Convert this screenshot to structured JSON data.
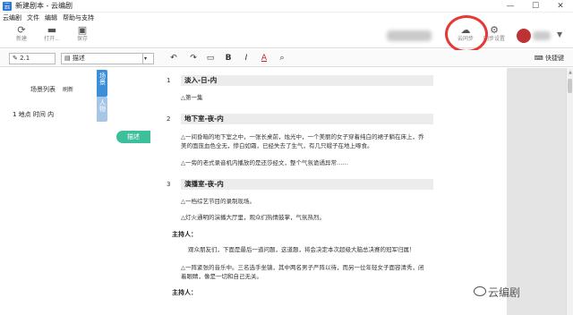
{
  "window": {
    "title": "新建剧本 - 云编剧",
    "minimize": "—",
    "maximize": "☐",
    "close": "✕"
  },
  "menu": [
    "云编剧",
    "文件",
    "编辑",
    "帮助与支持"
  ],
  "toolbar": {
    "new_label": "新建",
    "open_label": "打开...",
    "save_label": "保存",
    "sync_label": "云同步",
    "settings_label": "同步设置"
  },
  "format_bar": {
    "scene_index": "2.1",
    "element_type": "描述",
    "bold": "B",
    "italic": "I",
    "color": "A",
    "shortcut_label": "快捷键"
  },
  "left_panel": {
    "title": "场景列表",
    "refresh": "刷新",
    "scenes": [
      "1 地点 时间 内"
    ]
  },
  "tabs": {
    "scene": "场景",
    "character": "人物"
  },
  "active_element_tag": "描述",
  "script": {
    "scenes": [
      {
        "number": "1",
        "heading": "淡入-日-内",
        "lines": [
          "△第一集"
        ]
      },
      {
        "number": "2",
        "heading": "地下室-夜-内",
        "lines": [
          "△一间昏暗的地下室之中，一张长桌前，烛光中，一个美丽的女子穿着纯白的裙子躺在床上，乔",
          "美的面庞血色全无，惨白如霜，已经失去了生气，有几只蛾子在地上啄食。",
          "△一旁的老式录音机内播放的是还莎经文，整个气氛诡谲异常……"
        ]
      },
      {
        "number": "3",
        "heading": "演播室-夜-内",
        "lines": [
          "△一档综艺节目的录制现场。",
          "△灯火通明的演播大厅里，观众们热情鼓掌，气氛热烈。"
        ]
      }
    ],
    "dialogues": [
      {
        "character": "主持人：",
        "line": "观众朋友们，下面是最后一道问题，这道题，将会决定本次超级大脑总决赛的冠军归属！"
      },
      {
        "character": "主持人：",
        "line": ""
      }
    ],
    "action_after": [
      "△一阵紧张的音乐中。三名选手坐镇，其中两名男子严阵以待，而另一位年轻女子面容清秀，闭",
      "着眼睛，像是一切和自己无关。"
    ]
  },
  "watermark": "云编剧"
}
